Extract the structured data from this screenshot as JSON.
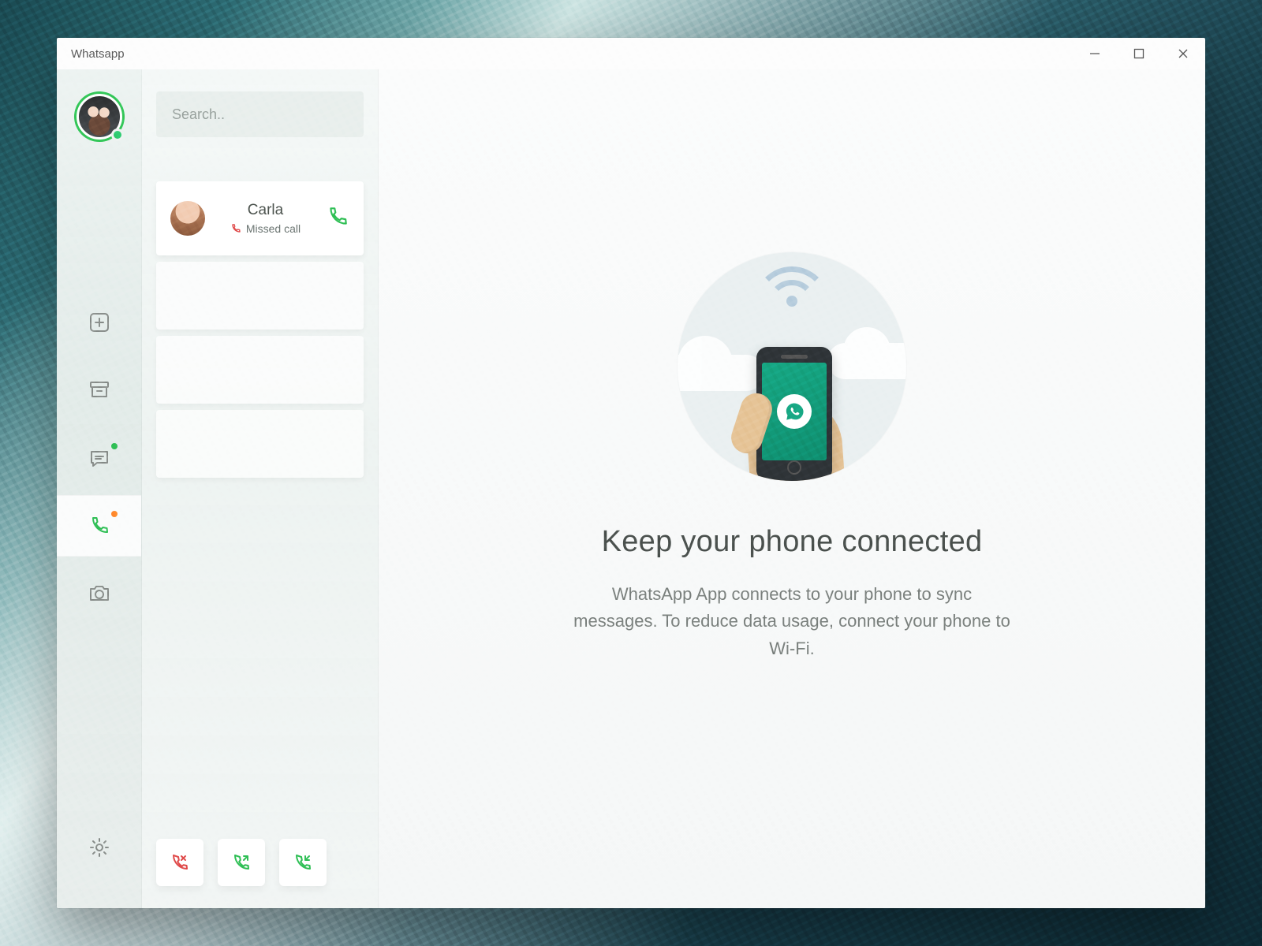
{
  "window": {
    "title": "Whatsapp"
  },
  "sidebar": {
    "items": [
      {
        "id": "new",
        "dot": null
      },
      {
        "id": "archive",
        "dot": null
      },
      {
        "id": "chats",
        "dot": "green"
      },
      {
        "id": "calls",
        "dot": "orange",
        "active": true
      },
      {
        "id": "camera",
        "dot": null
      }
    ]
  },
  "search": {
    "placeholder": "Search.."
  },
  "callList": {
    "items": [
      {
        "name": "Carla",
        "sub": "Missed call",
        "subKind": "missed"
      }
    ]
  },
  "filters": [
    {
      "id": "missed",
      "color": "#e04b4b"
    },
    {
      "id": "outgoing",
      "color": "#2fbf55"
    },
    {
      "id": "incoming",
      "color": "#2fbf55"
    }
  ],
  "main": {
    "headline": "Keep your phone connected",
    "subtext": "WhatsApp App connects to your phone to sync messages. To reduce data usage, connect your phone to Wi-Fi."
  }
}
